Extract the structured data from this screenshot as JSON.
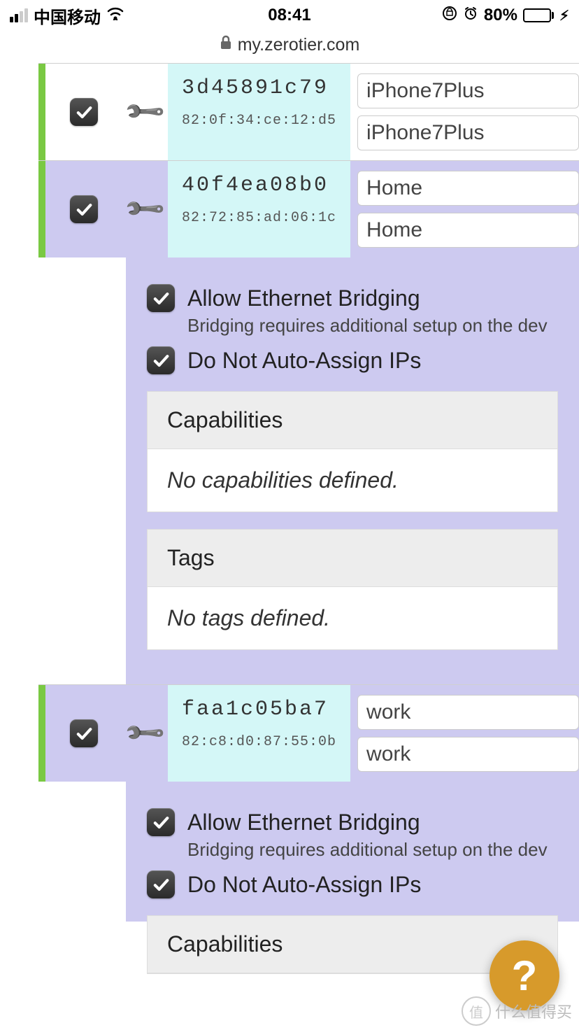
{
  "status": {
    "carrier": "中国移动",
    "time": "08:41",
    "battery_pct": "80%"
  },
  "browser": {
    "host": "my.zerotier.com"
  },
  "members": [
    {
      "node_id": "3d45891c79",
      "phys": "82:0f:34:ce:12:d5",
      "name": "iPhone7Plus",
      "desc": "iPhone7Plus"
    },
    {
      "node_id": "40f4ea08b0",
      "phys": "82:72:85:ad:06:1c",
      "name": "Home",
      "desc": "Home"
    },
    {
      "node_id": "faa1c05ba7",
      "phys": "82:c8:d0:87:55:0b",
      "name": "work",
      "desc": "work"
    }
  ],
  "detail": {
    "bridge_label": "Allow Ethernet Bridging",
    "bridge_desc": "Bridging requires additional setup on the dev",
    "noauto_label": "Do Not Auto-Assign IPs",
    "caps_header": "Capabilities",
    "caps_body": "No capabilities defined.",
    "tags_header": "Tags",
    "tags_body": "No tags defined."
  },
  "help": "?",
  "watermark": "什么值得买",
  "watermark_badge": "值"
}
